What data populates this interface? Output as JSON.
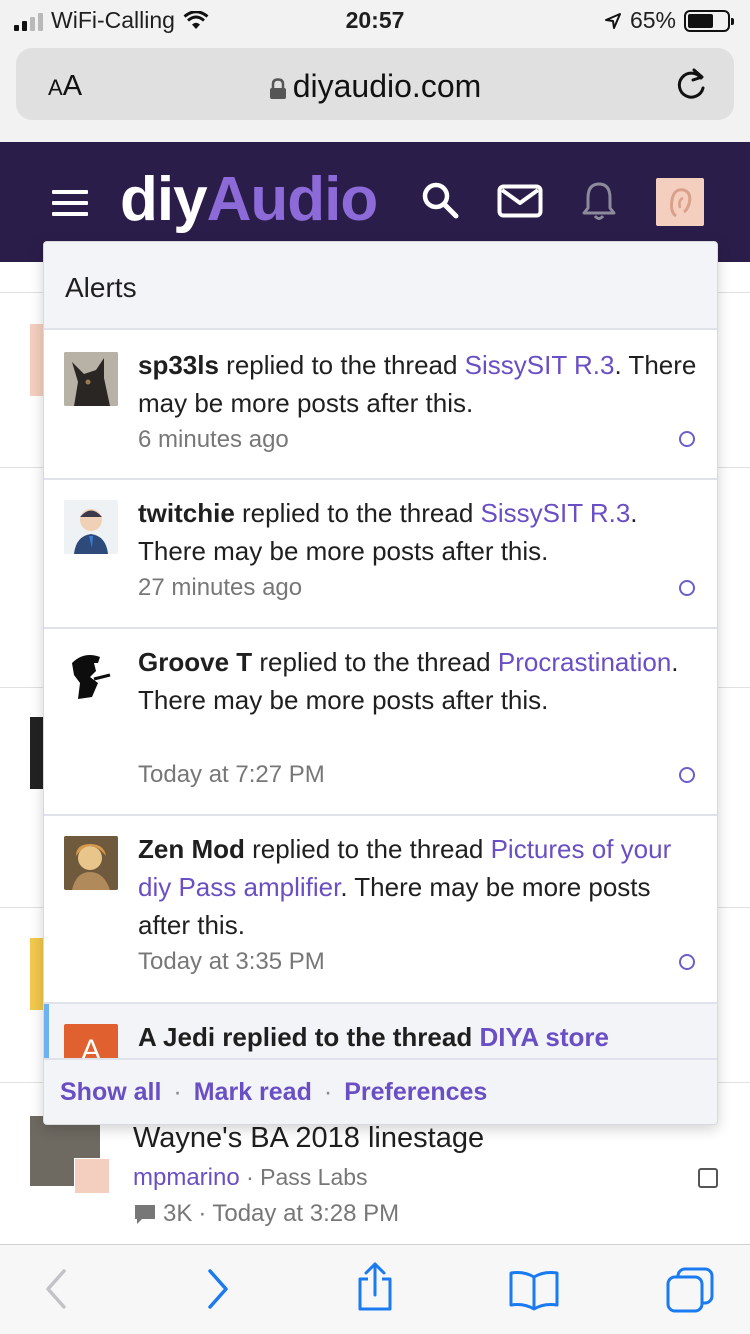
{
  "status_bar": {
    "carrier": "WiFi-Calling",
    "time": "20:57",
    "battery": "65%",
    "battery_level": 0.65
  },
  "browser": {
    "text_size_label_big": "A",
    "text_size_label_small": "A",
    "url": "diyaudio.com"
  },
  "site_header": {
    "logo_part1": "diy",
    "logo_part2": "Audio",
    "icons": [
      "menu-icon",
      "search-icon",
      "mail-icon",
      "bell-icon",
      "avatar"
    ],
    "brand_color": "#2b1d4a",
    "accent_color": "#8c6bd9"
  },
  "alerts": {
    "title": "Alerts",
    "items": [
      {
        "user": "sp33ls",
        "action": " replied to the thread ",
        "thread": "SissySIT R.3",
        "suffix": ". There may be more posts after this.",
        "time": "6 minutes ago",
        "unread": false
      },
      {
        "user": "twitchie",
        "action": " replied to the thread ",
        "thread": "SissySIT R.3",
        "suffix": ". There may be more posts after this.",
        "time": "27 minutes ago",
        "unread": false
      },
      {
        "user": "Groove T",
        "action": " replied to the thread ",
        "thread": "Procrastination",
        "suffix": ". There may be more posts after this.",
        "time": "Today at 7:27 PM",
        "unread": false
      },
      {
        "user": "Zen Mod",
        "action": " replied to the thread ",
        "thread": "Pictures of your diy Pass amplifier",
        "suffix": ". There may be more posts after this.",
        "time": "Today at 3:35 PM",
        "unread": false
      },
      {
        "user": "A Jedi",
        "action": " replied to the thread ",
        "thread": "DIYA store",
        "avatar_letter": "A",
        "unread": true
      }
    ],
    "footer": {
      "show_all": "Show all",
      "separator": "·",
      "mark_read": "Mark read",
      "preferences": "Preferences"
    }
  },
  "background_thread": {
    "title": "Wayne's BA 2018 linestage",
    "author": "mpmarino",
    "separator": "·",
    "forum": "Pass Labs",
    "replies": "3K",
    "last_post": "Today at 3:28 PM"
  },
  "toolbar": {
    "icons": [
      "back-icon",
      "forward-icon",
      "share-icon",
      "bookmarks-icon",
      "tabs-icon"
    ]
  },
  "colors": {
    "link": "#6a4fc4",
    "ios_blue": "#1a7bf0",
    "unread_marker": "#6db2f0"
  }
}
